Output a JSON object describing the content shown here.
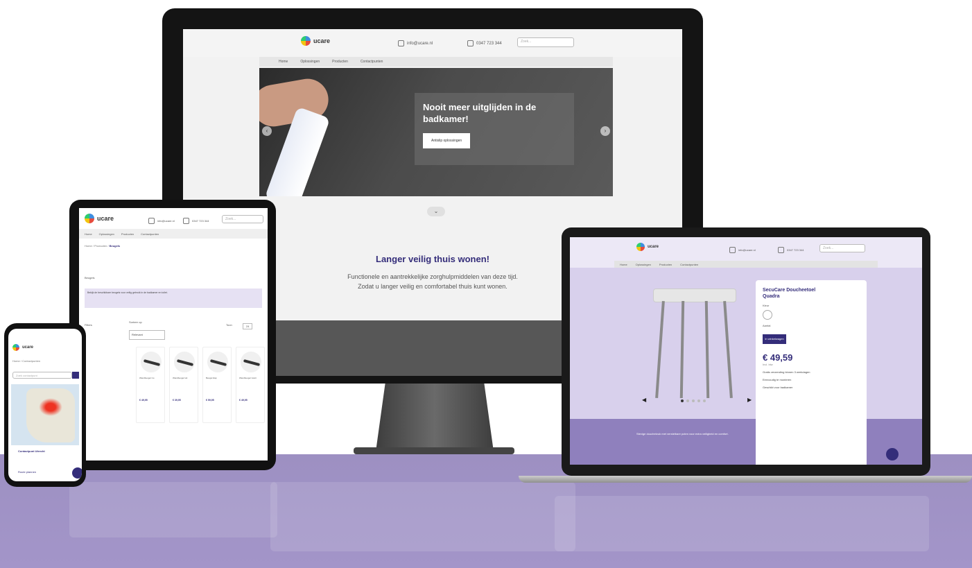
{
  "site": {
    "logo_text": "ucare",
    "email": "info@ucare.nl",
    "phone": "0347 723 344",
    "search_placeholder": "Zoek...",
    "nav": [
      "Home",
      "Oplossingen",
      "Producten",
      "Contactpunten"
    ]
  },
  "monitor": {
    "hero_title": "Nooit meer uitglijden in de badkamer!",
    "hero_button": "Antislip oplossingen",
    "heading": "Langer veilig thuis wonen!",
    "body_line1": "Functionele en aantrekkelijke zorghulpmiddelen van deze tijd.",
    "body_line2": "Zodat u langer veilig en comfortabel thuis kunt wonen."
  },
  "tablet": {
    "breadcrumb_home": "Home",
    "breadcrumb_products": "Producten",
    "breadcrumb_current": "Beugels",
    "section_title": "Beugels",
    "alert_text": "Bekijk de beschikbare beugels voor veilig gebruik in de badkamer en toilet.",
    "filter_label": "Filters",
    "sort_label": "Sorteer op",
    "sort_value": "Relevant",
    "show_label": "Toon",
    "show_value": "24",
    "products": [
      {
        "title": "Wandbeugel rvs",
        "price": "€ 49,95"
      },
      {
        "title": "Wandbeugel wit",
        "price": "€ 39,95"
      },
      {
        "title": "Beugel klap",
        "price": "€ 59,95"
      },
      {
        "title": "Wandbeugel zwart",
        "price": "€ 49,95"
      }
    ]
  },
  "phone": {
    "logo_text": "ucare",
    "breadcrumb": "Home / Contactpunten",
    "search_placeholder": "Zoek contactpunt",
    "result_title": "Contactpunt Utrecht",
    "result_link": "Route plannen"
  },
  "laptop": {
    "product_title": "SecuCare Doucheetoel Quadra",
    "kleur_label": "Kleur",
    "qty_label": "Aantal",
    "cart_button": "In winkelwagen",
    "price": "€ 49,59",
    "price_note": "Incl. btw",
    "features": [
      "Gratis verzending binnen 3 werkdagen",
      "Eenvoudig te monteren",
      "Geschikt voor badkamer"
    ],
    "bottom_text": "Stevige douchekruk met verstelbare poten voor extra veiligheid en comfort."
  },
  "colors": {
    "brand": "#342d7a",
    "floor": "#9d90c2"
  }
}
